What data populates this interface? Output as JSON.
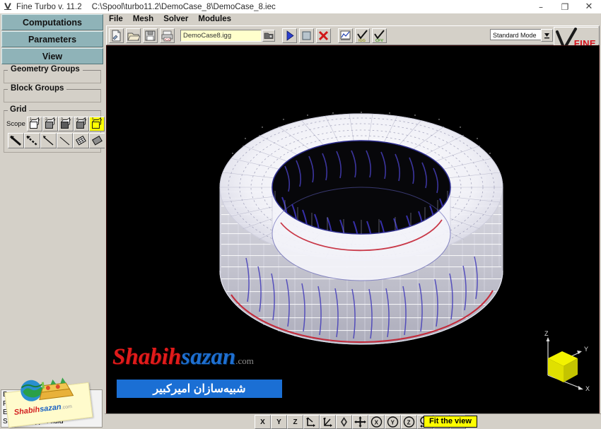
{
  "window": {
    "app_title": "Fine Turbo v. 11.2",
    "file_path": "C:\\Spool\\turbo11.2\\DemoCase_8\\DemoCase_8.iec",
    "minimize": "–",
    "maximize": "❐",
    "close": "✕"
  },
  "sidebar": {
    "tabs": [
      {
        "label": "Computations"
      },
      {
        "label": "Parameters"
      },
      {
        "label": "View"
      }
    ],
    "groups": [
      {
        "label": "Geometry Groups"
      },
      {
        "label": "Block Groups"
      }
    ],
    "grid": {
      "title": "Grid",
      "scope_label": "Scope",
      "scope_buttons": [
        {
          "name": "scope-block-1",
          "badge": "1",
          "selected": false
        },
        {
          "name": "scope-block-2",
          "badge": "2",
          "selected": false
        },
        {
          "name": "scope-block-3",
          "badge": "3",
          "selected": false
        },
        {
          "name": "scope-block-4",
          "badge": "4",
          "selected": false
        },
        {
          "name": "scope-block-5",
          "badge": "5",
          "selected": true
        }
      ],
      "tool_buttons": [
        {
          "name": "grid-line-bold-icon"
        },
        {
          "name": "grid-line-dashed-icon"
        },
        {
          "name": "grid-line-thin-icon"
        },
        {
          "name": "grid-line-plain-icon"
        },
        {
          "name": "grid-surface-mesh-icon"
        },
        {
          "name": "grid-surface-solid-icon"
        }
      ]
    }
  },
  "status": {
    "lines": [
      "B :",
      "F :",
      "E : 1 o",
      "S : 1 of 1           type: fluid"
    ]
  },
  "sticker": {
    "text_red": "Shabih",
    "text_blue": "sazan",
    "text_gray": ".com"
  },
  "menu": {
    "items": [
      {
        "label": "File"
      },
      {
        "label": "Mesh"
      },
      {
        "label": "Solver"
      },
      {
        "label": "Modules"
      }
    ]
  },
  "toolbar": {
    "buttons": [
      {
        "name": "new-project-icon",
        "title": "New"
      },
      {
        "name": "open-project-icon",
        "title": "Open"
      },
      {
        "name": "save-project-icon",
        "title": "Save"
      },
      {
        "name": "print-icon",
        "title": "Print"
      }
    ],
    "file_field_value": "DemoCase8.igg",
    "file_browse_icon": "folder-browse-icon",
    "action_buttons": [
      {
        "name": "run-icon",
        "title": "Start"
      },
      {
        "name": "stop-icon",
        "title": "Stop"
      },
      {
        "name": "kill-icon",
        "title": "Kill"
      },
      {
        "name": "monitor-icon",
        "title": "Monitor"
      },
      {
        "name": "igg-check-icon",
        "title": "IGG",
        "tag": "IGG"
      },
      {
        "name": "cfv-check-icon",
        "title": "CFV",
        "tag": "CFV"
      }
    ],
    "mode_value": "Standard Mode",
    "logo_text": "FINE"
  },
  "viewport": {
    "watermark_red": "Shabih",
    "watermark_blue": "sazan",
    "watermark_gray": ".com",
    "watermark_persian": "شبیه‌سازان امیرکبیر",
    "axis": {
      "x": "X",
      "y": "Y",
      "z": "Z"
    },
    "colors": {
      "background": "#000000",
      "mesh_primary": "#ffffff",
      "mesh_blade": "#3b34b8",
      "mesh_highlight": "#c42434",
      "cube": "#e5e500"
    }
  },
  "bottom_toolbar": {
    "buttons": [
      {
        "name": "view-axis-x-button",
        "label": "X"
      },
      {
        "name": "view-axis-y-button",
        "label": "Y"
      },
      {
        "name": "view-axis-z-button",
        "label": "Z"
      },
      {
        "name": "rotate-free-xy-icon",
        "label": ""
      },
      {
        "name": "rotate-free-xz-icon",
        "label": ""
      },
      {
        "name": "rotate-trackball-icon",
        "label": ""
      },
      {
        "name": "pan-icon",
        "label": ""
      },
      {
        "name": "rotate-x-icon",
        "label": ""
      },
      {
        "name": "rotate-y-icon",
        "label": ""
      },
      {
        "name": "rotate-z-icon",
        "label": ""
      },
      {
        "name": "zoom-pan-icon",
        "label": ""
      },
      {
        "name": "zoom-box-icon",
        "label": ""
      },
      {
        "name": "fit-view-icon",
        "label": ""
      }
    ],
    "tooltip": "Fit the view"
  }
}
